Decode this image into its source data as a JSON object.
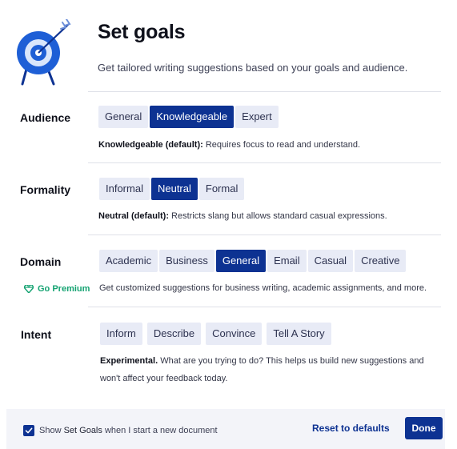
{
  "header": {
    "title": "Set goals",
    "subtitle": "Get tailored writing suggestions based on your goals and audience."
  },
  "audience": {
    "label": "Audience",
    "options": [
      "General",
      "Knowledgeable",
      "Expert"
    ],
    "selected": "Knowledgeable",
    "desc_bold": "Knowledgeable (default):",
    "desc_text": " Requires focus to read and understand."
  },
  "formality": {
    "label": "Formality",
    "options": [
      "Informal",
      "Neutral",
      "Formal"
    ],
    "selected": "Neutral",
    "desc_bold": "Neutral (default):",
    "desc_text": " Restricts slang but allows standard casual expressions."
  },
  "domain": {
    "label": "Domain",
    "options": [
      "Academic",
      "Business",
      "General",
      "Email",
      "Casual",
      "Creative"
    ],
    "selected": "General",
    "premium_label": "Go Premium",
    "desc_text": "Get customized suggestions for business writing, academic assignments, and more."
  },
  "intent": {
    "label": "Intent",
    "options": [
      "Inform",
      "Describe",
      "Convince",
      "Tell A Story"
    ],
    "desc_bold": "Experimental.",
    "desc_line1": " What are you trying to do? This helps us build new suggestions and",
    "desc_line2": "won't affect your feedback today."
  },
  "footer": {
    "checkbox_checked": true,
    "checkbox_text_pre": "Show ",
    "checkbox_text_bold": "Set Goals",
    "checkbox_text_post": " when I start a new document",
    "reset_label": "Reset to defaults",
    "done_label": "Done"
  },
  "colors": {
    "accent": "#0d3292",
    "option_bg": "#e8ebf6",
    "premium": "#15a372",
    "target_ring": "#1e5fd6"
  },
  "icons": {
    "header": "target-with-arrow-icon",
    "premium": "diamond-icon",
    "checkbox": "checkmark-icon"
  }
}
